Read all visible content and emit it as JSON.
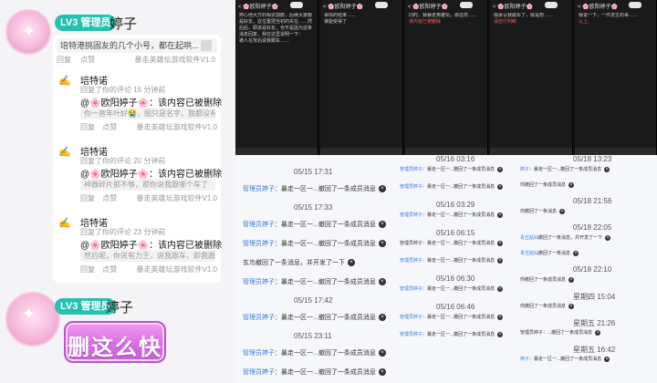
{
  "left": {
    "badge": "LV3 管理员",
    "username": "婷子",
    "top_card": {
      "preview": "培特港挑固友的几个小号，都在起哄...",
      "reply": "回复",
      "like": "点赞",
      "source": "暴走英雄坛游戏软件V1.0"
    },
    "notifications": [
      {
        "name": "培特诺",
        "sub": "回复了你的评论 16 分钟前",
        "at": "@",
        "flower": "🌸",
        "target": "欧阳婷子",
        "message": "：该内容已被删除",
        "quote": "你一直年叶好😭，图只是名字，我都没有...",
        "reply": "回复",
        "like": "点赞",
        "source": "暴走英雄坛游戏软件V1.0"
      },
      {
        "name": "培特诺",
        "sub": "回复了你的评论 20 分钟前",
        "at": "@",
        "flower": "🌸",
        "target": "欧阳婷子",
        "message": "：该内容已被删除",
        "quote": "神器碎片那不够，那你说我跟哪个车了",
        "reply": "回复",
        "like": "点赞",
        "source": "暴走英雄坛游戏软件V1.0"
      },
      {
        "name": "培特诺",
        "sub": "回复了你的评论 23 分钟前",
        "at": "@",
        "flower": "🌸",
        "target": "欧阳婷子",
        "message": "：该内容已被删除",
        "quote": "然后呢，你说有力王，说我跟车，即我跟...",
        "reply": "回复",
        "like": "点赞",
        "source": "暴走英雄坛游戏软件V1.0"
      }
    ],
    "second_badge": "LV3 管理员",
    "second_username": "婷子",
    "sticker_text": "删这么快"
  },
  "phones": [
    {
      "bar": "< 🌸欧阳婷子🌸",
      "text_a": "婷心他大方的相识加群，后续大家都是好友，这位置把当初的实在……然后后，即进是好友，也不是因为这条消息回复，我在这里说明一下：",
      "text_b": "被人在背后说我跟车……"
    },
    {
      "bar": "< 🌸欧阳婷子🌸",
      "text_a": "事情的结果……",
      "text_b": "谁能受得了"
    },
    {
      "bar": "< 🌸欧阳婷子🌸",
      "text_a": "同时，我暴走英雄坛，那这样……",
      "text_b": "该内容已被删除"
    },
    {
      "bar": "< 🌸欧阳婷子🌸",
      "text_a": "我承认我跟车了，就是想……",
      "text_b": "请自行判断"
    },
    {
      "bar": "< 🌸欧阳婷子🌸",
      "text_a": "我说一下，一件发生的事……",
      "text_b": "以上。"
    }
  ],
  "log": {
    "col1": [
      {
        "type": "time",
        "text": "05/15 17:31"
      },
      {
        "type": "msg",
        "who": "管理员婷子",
        "text": "：暴走一区一...撤回了一条成员消息"
      },
      {
        "type": "time",
        "text": "05/15 17:33"
      },
      {
        "type": "msg",
        "who": "管理员婷子",
        "text": "：暴走一区一...撤回了一条成员消息"
      },
      {
        "type": "msg",
        "who": "管理员婷子",
        "text": "：暴走一区一...撤回了一条成员消息"
      },
      {
        "type": "msg",
        "who": "",
        "text": "玄鸟撤回了一条消息，并开发了一下"
      },
      {
        "type": "msg",
        "who": "管理员婷子",
        "text": "：暴走一区一...撤回了一条成员消息"
      },
      {
        "type": "time",
        "text": "05/15 17:42"
      },
      {
        "type": "msg",
        "who": "管理员婷子",
        "text": "：暴走一区一...撤回了一条成员消息"
      },
      {
        "type": "time",
        "text": "05/15 23:11"
      },
      {
        "type": "msg",
        "who": "管理员婷子",
        "text": "：暴走一区一...撤回了一条成员消息"
      },
      {
        "type": "msg",
        "who": "管理员婷子",
        "text": "：暴走一区一...撤回了一条成员消息"
      }
    ],
    "col2": [
      {
        "type": "time",
        "text": "05/16 03:16"
      },
      {
        "type": "msg",
        "who": "管理员婷子",
        "text": "：暴走一区一...撤回了一条成员消息"
      },
      {
        "type": "msg",
        "who": "管理员婷子",
        "text": "：暴走一区一...撤回了一条成员消息"
      },
      {
        "type": "time",
        "text": "05/16 03:29"
      },
      {
        "type": "msg",
        "who": "管理员婷子",
        "text": "：暴走一区一...撤回了一条成员消息"
      },
      {
        "type": "time",
        "text": "05/16 06:15"
      },
      {
        "type": "msg",
        "who": "",
        "text": "管理员婷子：暴走一区一...撤回了一条成员消息"
      },
      {
        "type": "msg",
        "who": "管理员婷子",
        "text": "：暴走一区一...撤回了一条成员消息"
      },
      {
        "type": "time",
        "text": "05/16 06:30"
      },
      {
        "type": "msg",
        "who": "管理员婷子",
        "text": "：暴走一区一...撤回了一条成员消息"
      },
      {
        "type": "time",
        "text": "05/16 06:46"
      },
      {
        "type": "msg",
        "who": "管理员婷子",
        "text": "：暴走一区一...撤回了一条成员消息"
      },
      {
        "type": "msg",
        "who": "管理员婷子",
        "text": "：暴走一区一...撤回了一条成员消息"
      }
    ],
    "col3": [
      {
        "type": "time",
        "text": "05/18 13:23"
      },
      {
        "type": "msg",
        "who": "婷子",
        "text": "：暴走一区一...撤回了一条成员消息"
      },
      {
        "type": "msg",
        "who": "",
        "text": "你撤回了一条成员消息"
      },
      {
        "type": "time",
        "text": "05/18 21:56"
      },
      {
        "type": "msg",
        "who": "",
        "text": "你撤回了一条消息"
      },
      {
        "type": "time",
        "text": "05/18 22:05"
      },
      {
        "type": "msg",
        "who": "青丘姑仙",
        "text": "撤回了一条消息，并开发了一下"
      },
      {
        "type": "msg",
        "who": "青丘姑仙",
        "text": "撤回了一条消息"
      },
      {
        "type": "time",
        "text": "05/18 22:10"
      },
      {
        "type": "msg",
        "who": "",
        "text": "你撤回了一条成员消息"
      },
      {
        "type": "time",
        "text": "星期四 15:04"
      },
      {
        "type": "msg",
        "who": "",
        "text": "你撤回了一条成员消息"
      },
      {
        "type": "time",
        "text": "星期五 21:26"
      },
      {
        "type": "msg",
        "who": "",
        "text": "管理员婷子：...撤回了一条成员消息"
      },
      {
        "type": "time",
        "text": "星期五 16:42"
      },
      {
        "type": "msg",
        "who": "婷子",
        "text": "：暴走一区一...撤回了一条成员消息"
      }
    ]
  }
}
